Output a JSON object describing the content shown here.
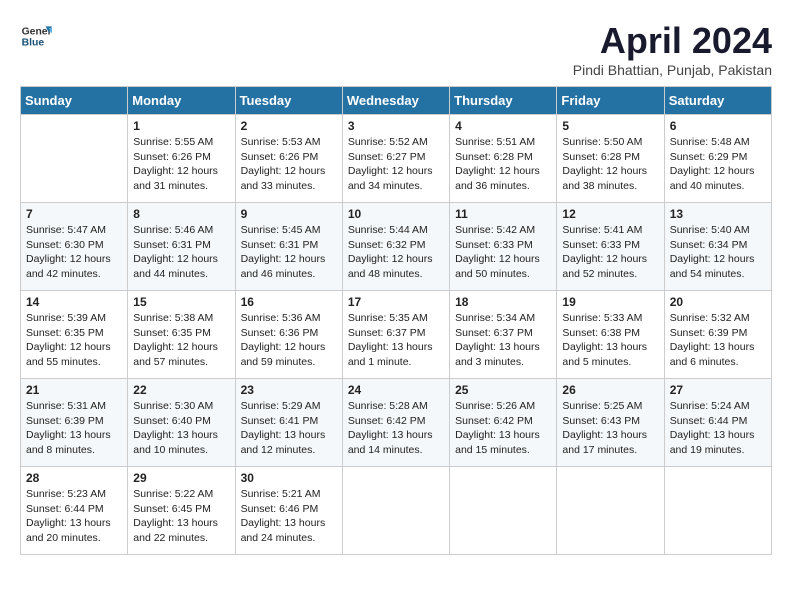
{
  "logo": {
    "general": "General",
    "blue": "Blue"
  },
  "title": "April 2024",
  "subtitle": "Pindi Bhattian, Punjab, Pakistan",
  "headers": [
    "Sunday",
    "Monday",
    "Tuesday",
    "Wednesday",
    "Thursday",
    "Friday",
    "Saturday"
  ],
  "weeks": [
    [
      {
        "num": "",
        "data": ""
      },
      {
        "num": "1",
        "data": "Sunrise: 5:55 AM\nSunset: 6:26 PM\nDaylight: 12 hours\nand 31 minutes."
      },
      {
        "num": "2",
        "data": "Sunrise: 5:53 AM\nSunset: 6:26 PM\nDaylight: 12 hours\nand 33 minutes."
      },
      {
        "num": "3",
        "data": "Sunrise: 5:52 AM\nSunset: 6:27 PM\nDaylight: 12 hours\nand 34 minutes."
      },
      {
        "num": "4",
        "data": "Sunrise: 5:51 AM\nSunset: 6:28 PM\nDaylight: 12 hours\nand 36 minutes."
      },
      {
        "num": "5",
        "data": "Sunrise: 5:50 AM\nSunset: 6:28 PM\nDaylight: 12 hours\nand 38 minutes."
      },
      {
        "num": "6",
        "data": "Sunrise: 5:48 AM\nSunset: 6:29 PM\nDaylight: 12 hours\nand 40 minutes."
      }
    ],
    [
      {
        "num": "7",
        "data": "Sunrise: 5:47 AM\nSunset: 6:30 PM\nDaylight: 12 hours\nand 42 minutes."
      },
      {
        "num": "8",
        "data": "Sunrise: 5:46 AM\nSunset: 6:31 PM\nDaylight: 12 hours\nand 44 minutes."
      },
      {
        "num": "9",
        "data": "Sunrise: 5:45 AM\nSunset: 6:31 PM\nDaylight: 12 hours\nand 46 minutes."
      },
      {
        "num": "10",
        "data": "Sunrise: 5:44 AM\nSunset: 6:32 PM\nDaylight: 12 hours\nand 48 minutes."
      },
      {
        "num": "11",
        "data": "Sunrise: 5:42 AM\nSunset: 6:33 PM\nDaylight: 12 hours\nand 50 minutes."
      },
      {
        "num": "12",
        "data": "Sunrise: 5:41 AM\nSunset: 6:33 PM\nDaylight: 12 hours\nand 52 minutes."
      },
      {
        "num": "13",
        "data": "Sunrise: 5:40 AM\nSunset: 6:34 PM\nDaylight: 12 hours\nand 54 minutes."
      }
    ],
    [
      {
        "num": "14",
        "data": "Sunrise: 5:39 AM\nSunset: 6:35 PM\nDaylight: 12 hours\nand 55 minutes."
      },
      {
        "num": "15",
        "data": "Sunrise: 5:38 AM\nSunset: 6:35 PM\nDaylight: 12 hours\nand 57 minutes."
      },
      {
        "num": "16",
        "data": "Sunrise: 5:36 AM\nSunset: 6:36 PM\nDaylight: 12 hours\nand 59 minutes."
      },
      {
        "num": "17",
        "data": "Sunrise: 5:35 AM\nSunset: 6:37 PM\nDaylight: 13 hours\nand 1 minute."
      },
      {
        "num": "18",
        "data": "Sunrise: 5:34 AM\nSunset: 6:37 PM\nDaylight: 13 hours\nand 3 minutes."
      },
      {
        "num": "19",
        "data": "Sunrise: 5:33 AM\nSunset: 6:38 PM\nDaylight: 13 hours\nand 5 minutes."
      },
      {
        "num": "20",
        "data": "Sunrise: 5:32 AM\nSunset: 6:39 PM\nDaylight: 13 hours\nand 6 minutes."
      }
    ],
    [
      {
        "num": "21",
        "data": "Sunrise: 5:31 AM\nSunset: 6:39 PM\nDaylight: 13 hours\nand 8 minutes."
      },
      {
        "num": "22",
        "data": "Sunrise: 5:30 AM\nSunset: 6:40 PM\nDaylight: 13 hours\nand 10 minutes."
      },
      {
        "num": "23",
        "data": "Sunrise: 5:29 AM\nSunset: 6:41 PM\nDaylight: 13 hours\nand 12 minutes."
      },
      {
        "num": "24",
        "data": "Sunrise: 5:28 AM\nSunset: 6:42 PM\nDaylight: 13 hours\nand 14 minutes."
      },
      {
        "num": "25",
        "data": "Sunrise: 5:26 AM\nSunset: 6:42 PM\nDaylight: 13 hours\nand 15 minutes."
      },
      {
        "num": "26",
        "data": "Sunrise: 5:25 AM\nSunset: 6:43 PM\nDaylight: 13 hours\nand 17 minutes."
      },
      {
        "num": "27",
        "data": "Sunrise: 5:24 AM\nSunset: 6:44 PM\nDaylight: 13 hours\nand 19 minutes."
      }
    ],
    [
      {
        "num": "28",
        "data": "Sunrise: 5:23 AM\nSunset: 6:44 PM\nDaylight: 13 hours\nand 20 minutes."
      },
      {
        "num": "29",
        "data": "Sunrise: 5:22 AM\nSunset: 6:45 PM\nDaylight: 13 hours\nand 22 minutes."
      },
      {
        "num": "30",
        "data": "Sunrise: 5:21 AM\nSunset: 6:46 PM\nDaylight: 13 hours\nand 24 minutes."
      },
      {
        "num": "",
        "data": ""
      },
      {
        "num": "",
        "data": ""
      },
      {
        "num": "",
        "data": ""
      },
      {
        "num": "",
        "data": ""
      }
    ]
  ]
}
